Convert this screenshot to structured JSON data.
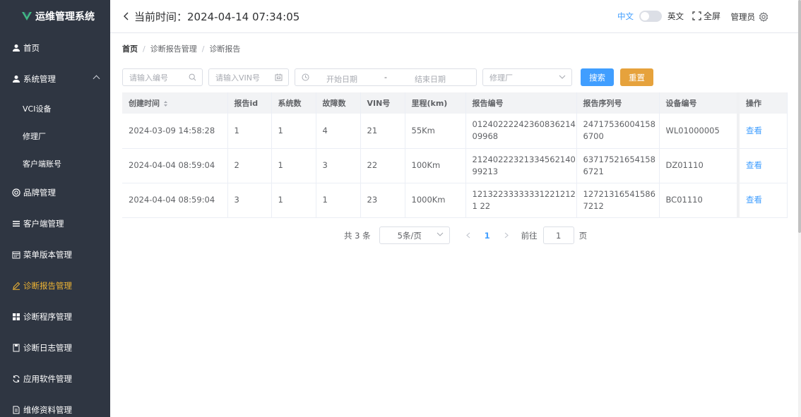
{
  "app": {
    "title": "运维管理系统",
    "brand_color": "#41b883"
  },
  "sidebar": {
    "items": [
      {
        "label": "首页",
        "icon": "user-icon"
      },
      {
        "label": "系统管理",
        "icon": "user-icon",
        "expanded": true
      },
      {
        "label": "VCI设备"
      },
      {
        "label": "修理厂"
      },
      {
        "label": "客户端账号"
      },
      {
        "label": "品牌管理",
        "icon": "brand-icon"
      },
      {
        "label": "客户端管理",
        "icon": "list-icon"
      },
      {
        "label": "菜单版本管理",
        "icon": "calendar-icon"
      },
      {
        "label": "诊断报告管理",
        "icon": "edit-icon",
        "active": true
      },
      {
        "label": "诊断程序管理",
        "icon": "grid-icon"
      },
      {
        "label": "诊断日志管理",
        "icon": "log-icon"
      },
      {
        "label": "应用软件管理",
        "icon": "refresh-icon"
      },
      {
        "label": "维修资料管理",
        "icon": "document-icon"
      }
    ],
    "active_color": "#f0b533",
    "bg_color": "#2f3642"
  },
  "header": {
    "time_label": "当前时间：2024-04-14 07:34:05",
    "lang_zh": "中文",
    "lang_en": "英文",
    "fullscreen": "全屏",
    "user": "管理员"
  },
  "breadcrumb": {
    "home": "首页",
    "level1": "诊断报告管理",
    "level2": "诊断报告"
  },
  "filters": {
    "code_placeholder": "请输入编号",
    "vin_placeholder": "请输入VIN号",
    "start_date": "开始日期",
    "sep": "-",
    "end_date": "结束日期",
    "shop_placeholder": "修理厂",
    "search_btn": "搜索",
    "reset_btn": "重置"
  },
  "table": {
    "headers": [
      "创建时间",
      "报告id",
      "系统数",
      "故障数",
      "VIN号",
      "里程(km)",
      "报告编号",
      "报告序列号",
      "设备编号",
      "操作"
    ],
    "rows": [
      [
        "2024-03-09 14:58:28",
        "1",
        "1",
        "4",
        "21",
        "55Km",
        "0124022224236083621409968",
        "247175360041586700",
        "WL01000005",
        "查看"
      ],
      [
        "2024-04-04 08:59:04",
        "2",
        "1",
        "3",
        "22",
        "100Km",
        "2124022232133456214099213",
        "637175216541586721",
        "DZ01110",
        "查看"
      ],
      [
        "2024-04-04 08:59:04",
        "3",
        "1",
        "1",
        "23",
        "1000Km",
        "121322333333312212121 22",
        "127213165415867212",
        "BC01110",
        "查看"
      ]
    ]
  },
  "pagination": {
    "total": "共 3 条",
    "page_size": "5条/页",
    "current": "1",
    "goto_label": "前往",
    "goto_value": "1",
    "page_suffix": "页"
  }
}
